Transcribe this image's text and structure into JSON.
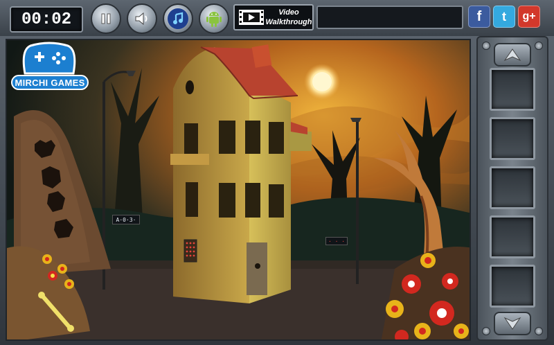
{
  "hud": {
    "timer": "00:02",
    "video_label_line1": "Video",
    "video_label_line2": "Walkthrough"
  },
  "social": {
    "facebook": "f",
    "twitter": "t",
    "googleplus": "g+"
  },
  "logo": {
    "text": "MIRCHI GAMES"
  },
  "scene": {
    "wall_code": "A·0·3·",
    "tree_code": "· · ·"
  },
  "colors": {
    "sky_glow": "#e29a2c",
    "house_wall": "#c9a84a",
    "roof": "#b8432f",
    "ground": "#3a302c"
  }
}
